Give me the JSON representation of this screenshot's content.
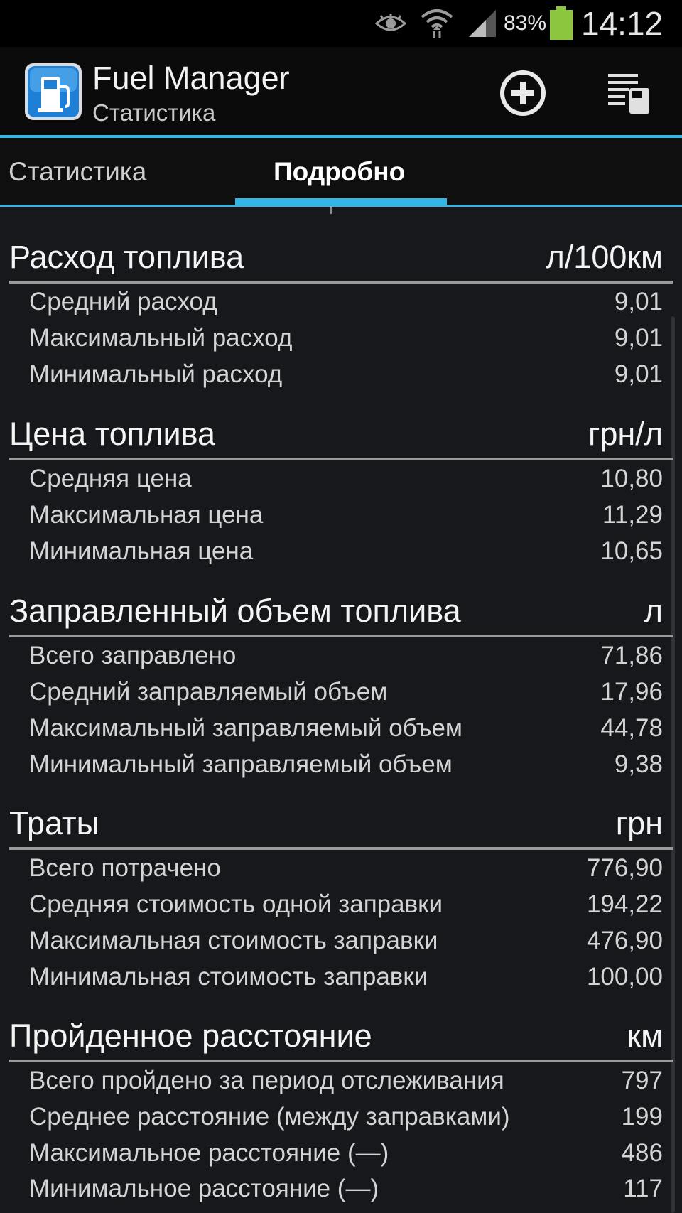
{
  "status_bar": {
    "battery_percent": "83%",
    "time": "14:12",
    "icons": [
      "eye-icon",
      "wifi-icon",
      "signal-icon",
      "battery-icon"
    ],
    "battery_level": 0.83
  },
  "action_bar": {
    "title": "Fuel Manager",
    "subtitle": "Статистика",
    "icons": [
      "fuel-app-icon",
      "add-circle-icon",
      "list-fuel-icon"
    ]
  },
  "tabs": [
    {
      "label": "Статистика",
      "selected": false
    },
    {
      "label": "Подробно",
      "selected": true
    }
  ],
  "sections": [
    {
      "title": "Расход топлива",
      "unit": "л/100км",
      "rows": [
        {
          "label": "Средний расход",
          "value": "9,01"
        },
        {
          "label": "Максимальный расход",
          "value": "9,01"
        },
        {
          "label": "Минимальный расход",
          "value": "9,01"
        }
      ]
    },
    {
      "title": "Цена топлива",
      "unit": "грн/л",
      "rows": [
        {
          "label": "Средняя цена",
          "value": "10,80"
        },
        {
          "label": "Максимальная цена",
          "value": "11,29"
        },
        {
          "label": "Минимальная цена",
          "value": "10,65"
        }
      ]
    },
    {
      "title": "Заправленный объем топлива",
      "unit": "л",
      "rows": [
        {
          "label": "Всего заправлено",
          "value": "71,86"
        },
        {
          "label": "Средний заправляемый объем",
          "value": "17,96"
        },
        {
          "label": "Максимальный заправляемый объем",
          "value": "44,78"
        },
        {
          "label": "Минимальный заправляемый объем",
          "value": "9,38"
        }
      ]
    },
    {
      "title": "Траты",
      "unit": "грн",
      "rows": [
        {
          "label": "Всего потрачено",
          "value": "776,90"
        },
        {
          "label": "Средняя стоимость одной заправки",
          "value": "194,22"
        },
        {
          "label": "Максимальная стоимость заправки",
          "value": "476,90"
        },
        {
          "label": "Минимальная стоимость заправки",
          "value": "100,00"
        }
      ]
    },
    {
      "title": "Пройденное расстояние",
      "unit": "км",
      "rows": [
        {
          "label": "Всего пройдено за период отслеживания",
          "value": "797"
        },
        {
          "label": "Среднее расстояние (между заправками)",
          "value": "199"
        },
        {
          "label": "Максимальное расстояние (—)",
          "value": "486"
        },
        {
          "label": "Минимальное расстояние (—)",
          "value": "117"
        }
      ]
    }
  ],
  "colors": {
    "accent": "#33b5e5",
    "background": "#16181b",
    "battery": "#8cc63f"
  }
}
